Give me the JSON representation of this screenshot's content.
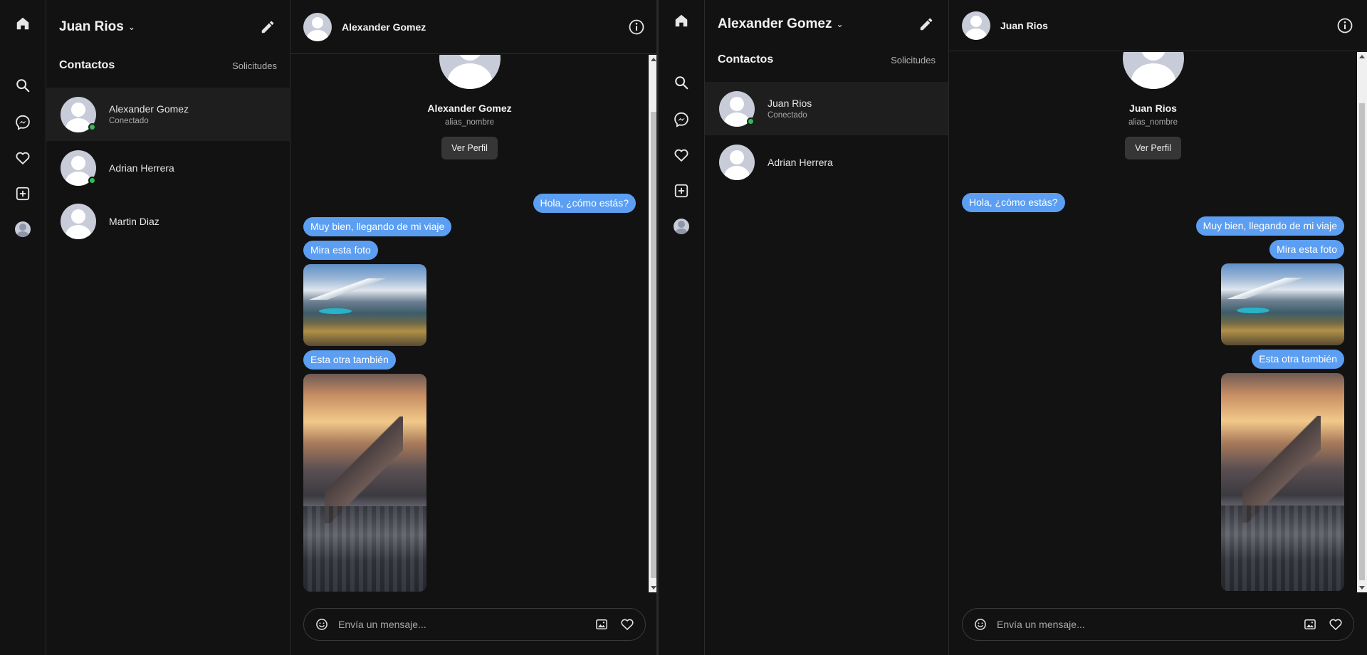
{
  "left": {
    "account_name": "Juan Rios",
    "contacts_title": "Contactos",
    "requests_label": "Solicitudes",
    "contacts": [
      {
        "name": "Alexander Gomez",
        "status": "Conectado"
      },
      {
        "name": "Adrian Herrera",
        "status": ""
      },
      {
        "name": "Martin Diaz",
        "status": ""
      }
    ],
    "chat": {
      "title": "Alexander Gomez",
      "profile_name": "Alexander Gomez",
      "profile_alias": "alias_nombre",
      "profile_button": "Ver Perfil",
      "messages": [
        {
          "text": "Hola, ¿cómo estás?",
          "side": "right"
        },
        {
          "text": "Muy bien, llegando de mi viaje",
          "side": "left"
        },
        {
          "text": "Mira esta foto",
          "side": "left"
        },
        {
          "text": "Esta otra también",
          "side": "left"
        }
      ],
      "composer_placeholder": "Envía un mensaje..."
    }
  },
  "right": {
    "account_name": "Alexander Gomez",
    "contacts_title": "Contactos",
    "requests_label": "Solicitudes",
    "contacts": [
      {
        "name": "Juan Rios",
        "status": "Conectado"
      },
      {
        "name": "Adrian Herrera",
        "status": ""
      }
    ],
    "chat": {
      "title": "Juan Rios",
      "profile_name": "Juan Rios",
      "profile_alias": "alias_nombre",
      "profile_button": "Ver Perfil",
      "messages": [
        {
          "text": "Hola, ¿cómo estás?",
          "side": "left"
        },
        {
          "text": "Muy bien, llegando de mi viaje",
          "side": "right"
        },
        {
          "text": "Mira esta foto",
          "side": "right"
        },
        {
          "text": "Esta otra también",
          "side": "right"
        }
      ],
      "composer_placeholder": "Envía un mensaje..."
    }
  },
  "colors": {
    "background": "#121212",
    "bubble": "#5b9ef2",
    "online": "#2fbd54",
    "divider": "#2a2a2a"
  },
  "icons": [
    "home-icon",
    "search-icon",
    "messenger-icon",
    "heart-icon",
    "add-post-icon",
    "profile-icon",
    "edit-icon",
    "info-icon",
    "emoji-icon",
    "image-icon"
  ]
}
